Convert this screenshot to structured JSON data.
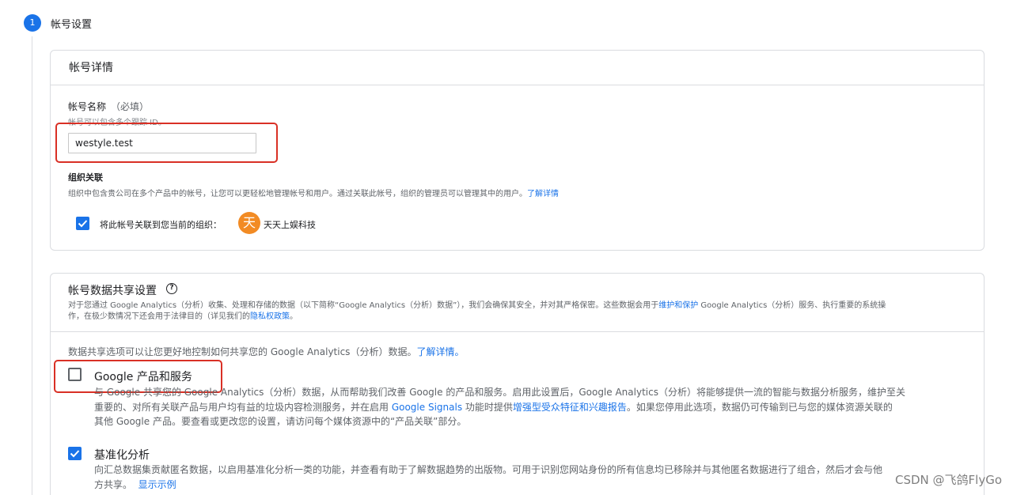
{
  "step": {
    "number": "1",
    "title": "帐号设置"
  },
  "account_details": {
    "header": "帐号详情",
    "name_label": "帐号名称",
    "name_required": "（必填）",
    "name_hint": "帐号可以包含多个跟踪 ID。",
    "name_value": "westyle.test",
    "org_title": "组织关联",
    "org_desc": "组织中包含贵公司在多个产品中的帐号，让您可以更轻松地管理帐号和用户。通过关联此帐号，组织的管理员可以管理其中的用户。",
    "org_learn_more": "了解详情",
    "link_checkbox_label": "将此帐号关联到您当前的组织：",
    "org_avatar_letter": "天",
    "org_name": "天天上娱科技",
    "link_checked": true
  },
  "data_sharing": {
    "header": "帐号数据共享设置",
    "desc_line1_a": "对于您通过 Google Analytics（分析）收集、处理和存储的数据（以下简称“Google Analytics（分析）数据”），我们会确保其安全，并对其严格保密。这些数据会用于",
    "desc_line1_link": "维护和保护",
    "desc_line1_b": " Google Analytics（分析）服务、执行重要的系统操",
    "desc_line2_a": "作，在极少数情况下还会用于法律目的（详见我们的",
    "desc_line2_link": "隐私权政策",
    "desc_line2_b": "。",
    "intro_text": "数据共享选项可以让您更好地控制如何共享您的 Google Analytics（分析）数据。",
    "intro_link": "了解详情。",
    "options": [
      {
        "title": "Google 产品和服务",
        "checked": false,
        "line1": "与 Google 共享您的 Google Analytics（分析）数据，从而帮助我们改善 Google 的产品和服务。启用此设置后，Google Analytics（分析）将能够提供一流的智能与数据分析服务，维护至关",
        "line2_a": "重要的、对所有关联产品与用户均有益的垃圾内容检测服务，并在启用 ",
        "line2_link1": "Google Signals",
        "line2_b": " 功能时提供",
        "line2_link2": "增强型受众特征和兴趣报告",
        "line2_c": "。如果您停用此选项，数据仍可传输到已与您的媒体资源关联的",
        "line3": "其他 Google 产品。要查看或更改您的设置，请访问每个媒体资源中的“产品关联”部分。"
      },
      {
        "title": "基准化分析",
        "checked": true,
        "line1": "向汇总数据集贡献匿名数据，以启用基准化分析一类的功能，并查看有助于了解数据趋势的出版物。可用于识别您网站身份的所有信息均已移除并与其他匿名数据进行了组合，然后才会与他",
        "line2_a": "方共享。",
        "line2_link": "显示示例"
      }
    ]
  },
  "watermark": "CSDN @飞鸽FlyGo"
}
